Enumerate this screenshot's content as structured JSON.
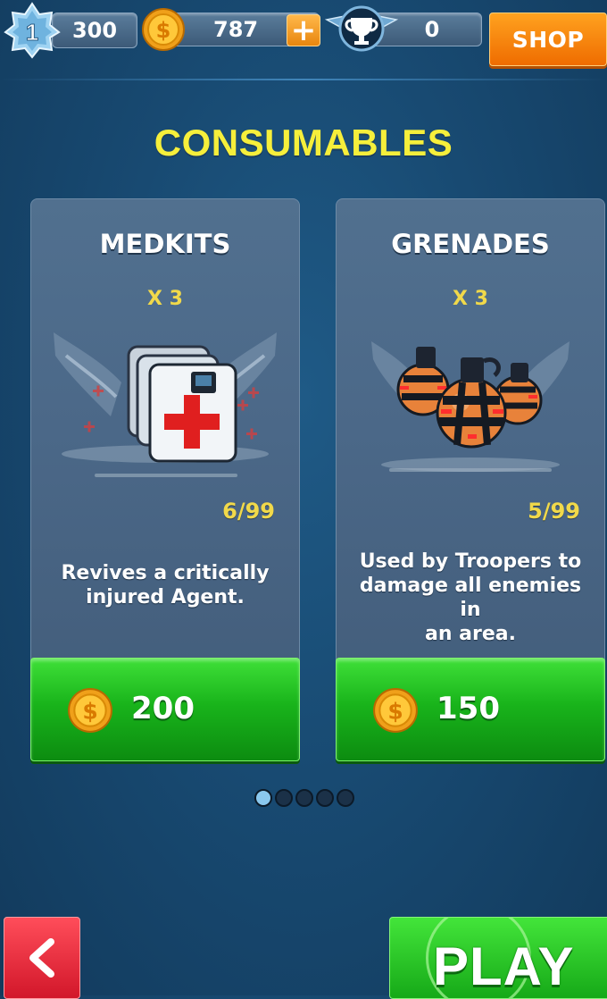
{
  "header": {
    "level": "1",
    "xp": "300",
    "coins": "787",
    "add_coins_label": "+",
    "trophies": "0",
    "shop_label": "SHOP"
  },
  "page": {
    "title": "CONSUMABLES"
  },
  "items": [
    {
      "name": "MEDKITS",
      "quantity": "X 3",
      "stock": "6/99",
      "description_lines": [
        "Revives a critically",
        "injured Agent."
      ],
      "price": "200",
      "icon": "medkit-icon"
    },
    {
      "name": "GRENADES",
      "quantity": "X 3",
      "stock": "5/99",
      "description_lines": [
        "Used by Troopers to",
        "damage all enemies in",
        "an area."
      ],
      "price": "150",
      "icon": "grenade-icon"
    }
  ],
  "pagination": {
    "total_pages": 5,
    "current_page": 1
  },
  "footer": {
    "back_icon": "chevron-left-icon",
    "play_label": "PLAY"
  },
  "colors": {
    "title_yellow": "#f6ef3b",
    "stock_yellow": "#f1d94a",
    "buy_green": "#19b41b",
    "shop_orange": "#ef6c00",
    "back_red": "#d2172a"
  }
}
